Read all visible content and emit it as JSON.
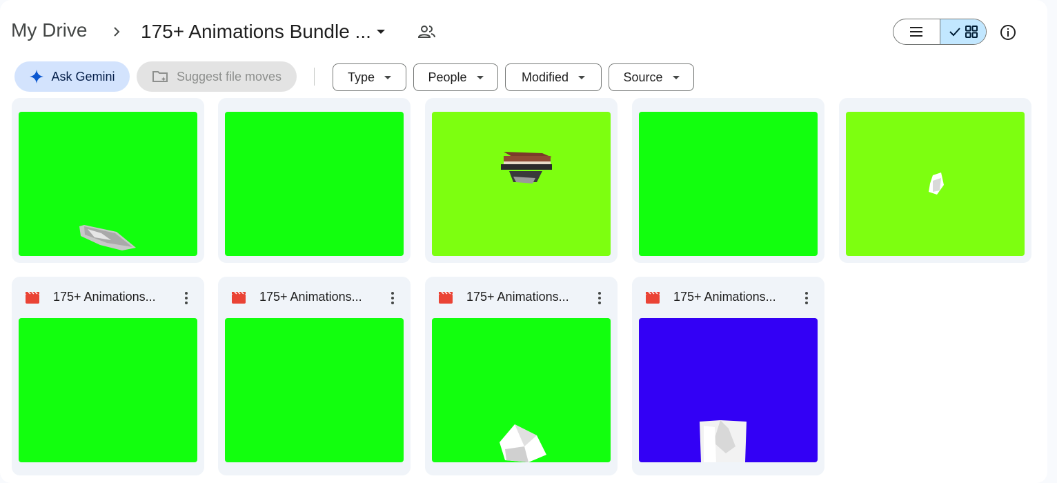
{
  "header": {
    "root": "My Drive",
    "current_folder": "175+ Animations Bundle ..."
  },
  "icons": {
    "chevron": "chevron-right-icon",
    "share": "people-icon",
    "list": "list-view-icon",
    "grid": "grid-view-icon",
    "info": "info-icon",
    "file": "video-file-icon"
  },
  "toolbar": {
    "ask_gemini": "Ask Gemini",
    "suggest_moves": "Suggest file moves",
    "filters": [
      "Type",
      "People",
      "Modified",
      "Source"
    ]
  },
  "colors": {
    "green": "#12ff0e",
    "lime": "#7dff10",
    "blue": "#3300f5",
    "accent": "#0b57d0",
    "file_icon": "#ea4335"
  },
  "files": [
    {
      "title": "",
      "thumb": "green",
      "object": "crumpled-paper"
    },
    {
      "title": "",
      "thumb": "green",
      "object": "none"
    },
    {
      "title": "",
      "thumb": "lime",
      "object": "stack-of-books"
    },
    {
      "title": "",
      "thumb": "green",
      "object": "none"
    },
    {
      "title": "",
      "thumb": "lime",
      "object": "small-paper"
    },
    {
      "title": "175+ Animations...",
      "thumb": "green",
      "object": "none"
    },
    {
      "title": "175+ Animations...",
      "thumb": "green",
      "object": "none"
    },
    {
      "title": "175+ Animations...",
      "thumb": "green",
      "object": "folded-paper"
    },
    {
      "title": "175+ Animations...",
      "thumb": "blue",
      "object": "paper-box"
    }
  ]
}
